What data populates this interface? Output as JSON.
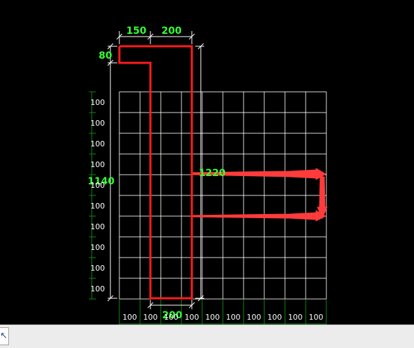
{
  "colors": {
    "background": "#000000",
    "grid": "#ffffff",
    "axis": "#118811",
    "section": "#ff1c1c",
    "dim_line": "#ffffff",
    "dim_text": "#33ff33",
    "scale_text": "#ffffff",
    "arrow": "#ff3b3b"
  },
  "drawing": {
    "top_flange_width": "150",
    "top_web_width": "200",
    "flange_thickness": "80",
    "total_height": "1140",
    "offset_dimension": "1220",
    "bottom_width": "200"
  },
  "grid": {
    "x_scale_labels": [
      "100",
      "100",
      "100",
      "100",
      "100",
      "100",
      "100",
      "100",
      "100",
      "100"
    ],
    "y_scale_labels": [
      "100",
      "100",
      "100",
      "100",
      "100",
      "100",
      "100",
      "100",
      "100",
      "100"
    ]
  },
  "statusbar": {
    "icon": "cursor-arrow-icon"
  }
}
